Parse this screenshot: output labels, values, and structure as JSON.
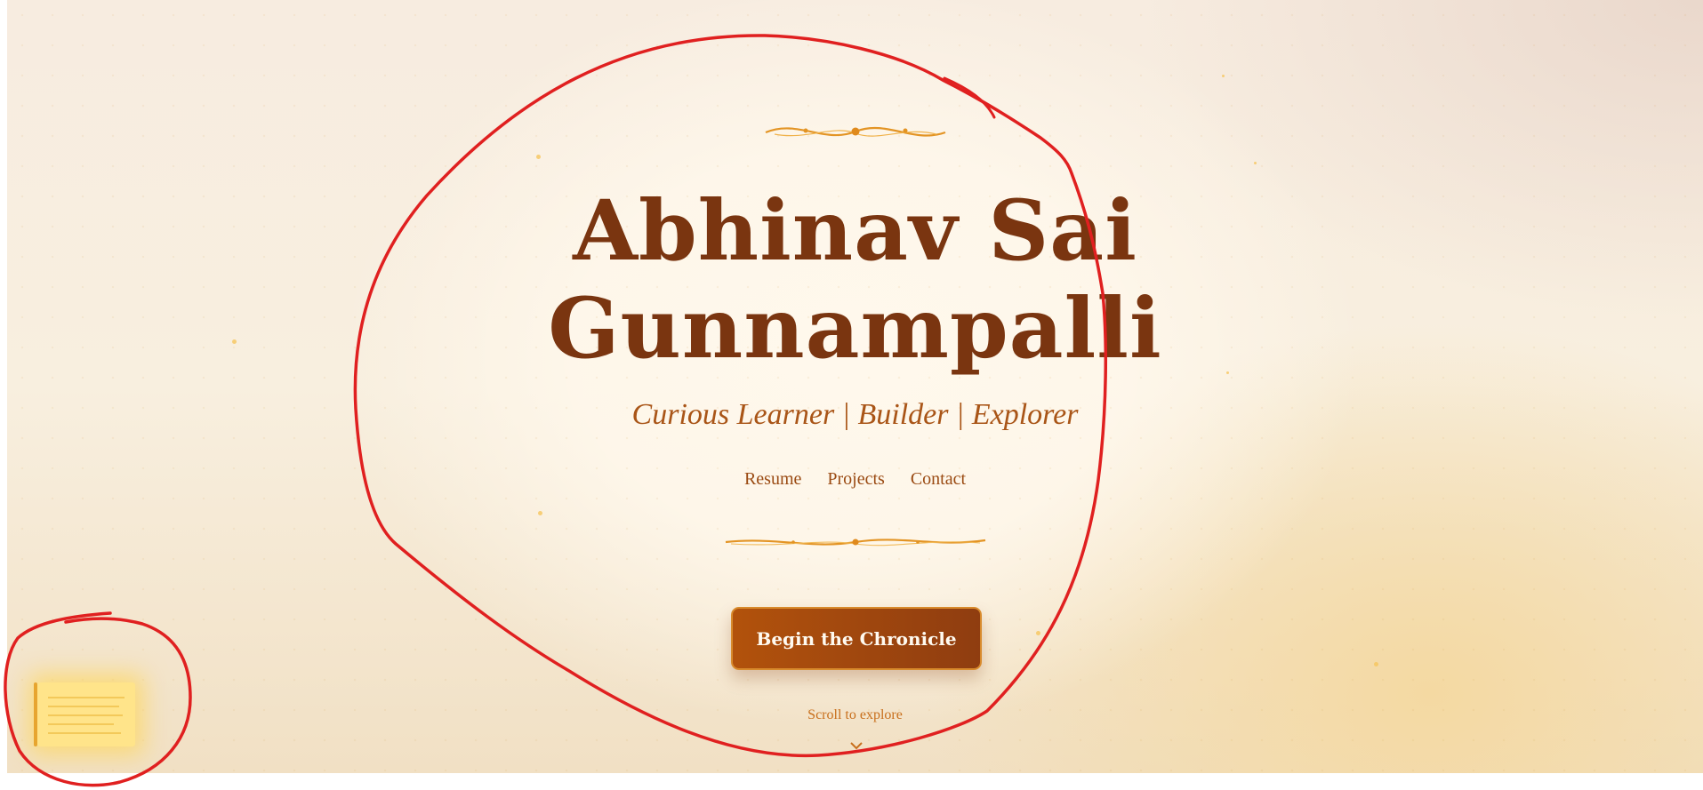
{
  "hero": {
    "name_line1": "Abhinav Sai",
    "name_line2": "Gunnampalli",
    "tagline": "Curious Learner | Builder | Explorer"
  },
  "nav": {
    "items": [
      {
        "label": "Resume"
      },
      {
        "label": "Projects"
      },
      {
        "label": "Contact"
      }
    ]
  },
  "cta": {
    "label": "Begin the Chronicle"
  },
  "scroll": {
    "hint": "Scroll to explore"
  },
  "icons": {
    "top_ornament": "flourish-divider-icon",
    "bottom_ornament": "flourish-divider-icon",
    "scroll_arrow": "chevron-down-icon",
    "scroll_widget": "parchment-scroll-icon"
  },
  "colors": {
    "title": "#7a3510",
    "tagline": "#a95517",
    "accent": "#e39424",
    "button": "#a04810",
    "annotation": "#e02020"
  }
}
